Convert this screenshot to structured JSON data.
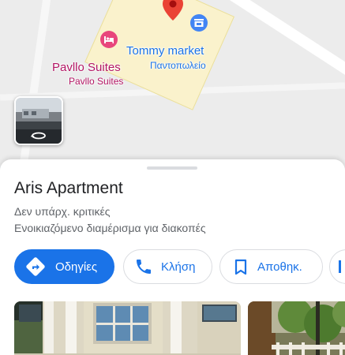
{
  "map": {
    "shop_label": "Tommy market",
    "shop_category": "Παντοπωλείο",
    "hotel_label": "Pavllo Suites",
    "hotel_sublabel": "Pavllo Suites",
    "pin_icon": "red-location-pin",
    "hotel_icon": "hotel-bed-icon",
    "shop_icon": "shopping-store-icon",
    "streetview_icon": "street-view-rotate-icon"
  },
  "place": {
    "name": "Aris Apartment",
    "reviews": "Δεν υπάρχ. κριτικές",
    "category": "Ενοικιαζόμενο διαμέρισμα για διακοπές"
  },
  "actions": {
    "directions": "Οδηγίες",
    "call": "Κλήση",
    "save": "Αποθηκ."
  },
  "colors": {
    "accent": "#1a73e8",
    "pin": "#ea4335",
    "hotel": "#e8467c",
    "shop": "#4285f4",
    "hotel_text": "#b31664"
  }
}
